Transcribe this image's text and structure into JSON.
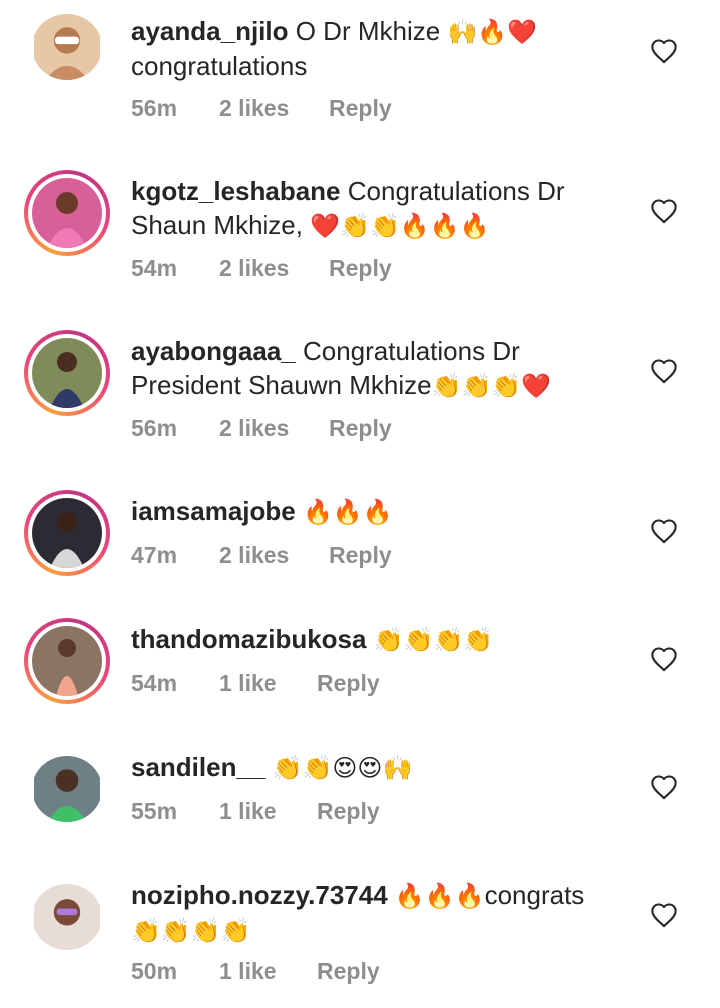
{
  "comments": [
    {
      "username": "ayanda_njilo",
      "text": "O Dr Mkhize",
      "emoji": "🙌🔥❤️",
      "text2": "congratulations",
      "time": "56m",
      "likes": "2 likes",
      "reply": "Reply",
      "story_ring": false,
      "avatar_color": "#d8b190"
    },
    {
      "username": "kgotz_leshabane",
      "text": "Congratulations Dr Shaun Mkhize,",
      "emoji": "❤️👏👏🔥🔥🔥",
      "time": "54m",
      "likes": "2 likes",
      "reply": "Reply",
      "story_ring": true,
      "avatar_color": "#c94f8a"
    },
    {
      "username": "ayabongaaa_",
      "text": "Congratulations Dr President Shauwn Mkhize",
      "emoji": "👏👏👏❤️",
      "time": "56m",
      "likes": "2 likes",
      "reply": "Reply",
      "story_ring": true,
      "avatar_color": "#6d7a52"
    },
    {
      "username": "iamsamajobe",
      "text": "",
      "emoji": "🔥🔥🔥",
      "time": "47m",
      "likes": "2 likes",
      "reply": "Reply",
      "story_ring": true,
      "avatar_color": "#3a3b40"
    },
    {
      "username": "thandomazibukosa",
      "text": "",
      "emoji": "👏👏👏👏",
      "time": "54m",
      "likes": "1 like",
      "reply": "Reply",
      "story_ring": true,
      "avatar_color": "#a1897a"
    },
    {
      "username": "sandilen__",
      "text": "",
      "emoji": "👏👏😍😍🙌",
      "time": "55m",
      "likes": "1 like",
      "reply": "Reply",
      "story_ring": false,
      "avatar_color": "#5d6e73"
    },
    {
      "username": "nozipho.nozzy.73744",
      "text": "",
      "emoji": "🔥🔥🔥",
      "text2": "congrats",
      "emoji2": "👏👏👏👏",
      "time": "50m",
      "likes": "1 like",
      "reply": "Reply",
      "story_ring": false,
      "avatar_color": "#c9a99a"
    }
  ],
  "colors": {
    "text": "#262626",
    "meta": "#8e8e8e",
    "story_ring_start": "#f9a03f",
    "story_ring_end": "#c13584"
  },
  "icons": {
    "like": "heart-outline-icon"
  }
}
